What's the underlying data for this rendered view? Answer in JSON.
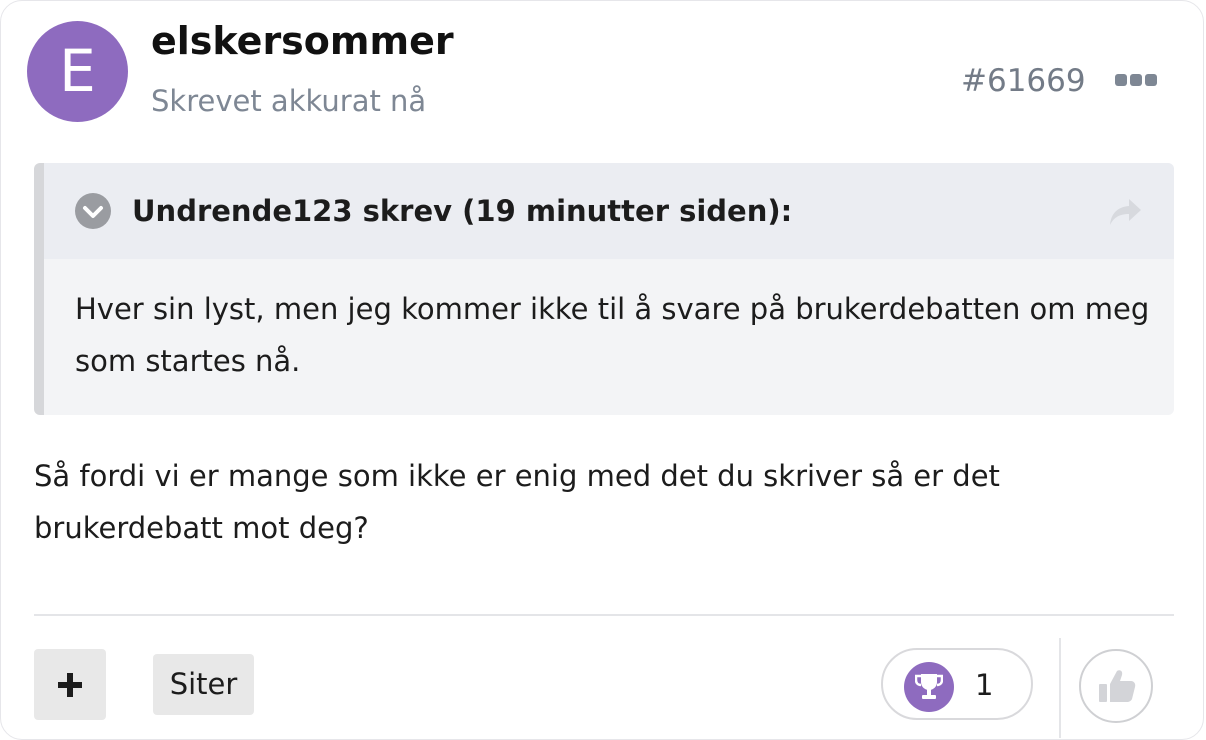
{
  "post": {
    "avatar_letter": "E",
    "avatar_color": "#8e6bbf",
    "username": "elskersommer",
    "timestamp": "Skrevet akkurat nå",
    "post_number": "#61669",
    "menu_icon": "more-horizontal-icon"
  },
  "quote": {
    "author_line": "Undrende123 skrev (19 minutter siden):",
    "text": "Hver sin lyst, men jeg kommer ikke til å svare på brukerdebatten om meg som startes nå.",
    "collapse_icon": "chevron-down-circle-icon",
    "jump_icon": "share-arrow-icon"
  },
  "body": {
    "text": "Så fordi vi er mange som ikke er enig med det du skriver så er det brukerdebatt mot deg?"
  },
  "actions": {
    "plus_icon": "plus-icon",
    "quote_label": "Siter",
    "reaction_icon": "trophy-icon",
    "reaction_count": "1",
    "reaction_color": "#8e6bbf",
    "like_icon": "thumbs-up-icon"
  }
}
